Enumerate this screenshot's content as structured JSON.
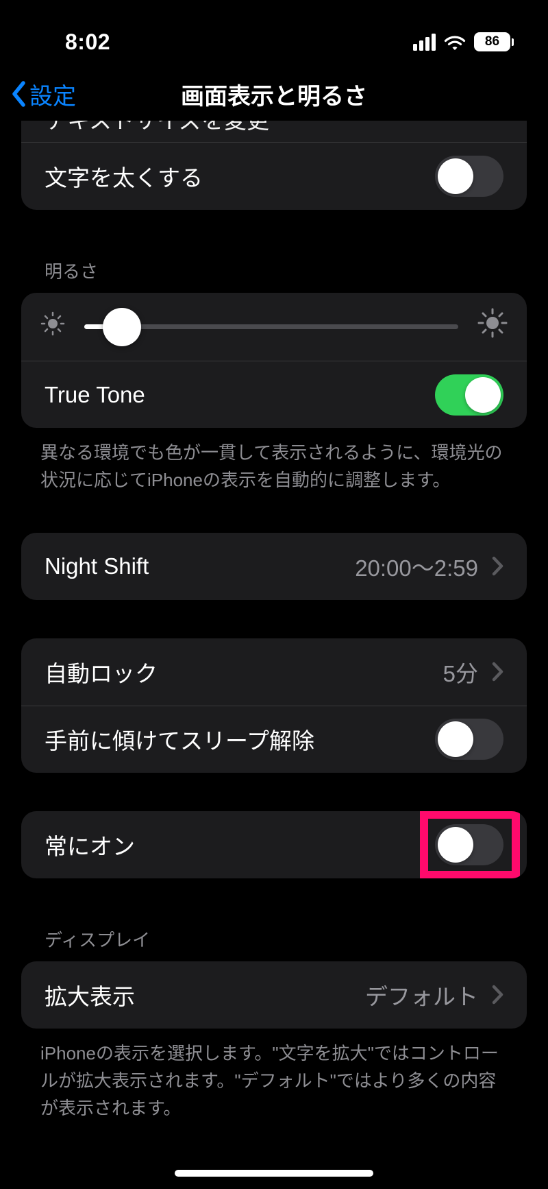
{
  "statusbar": {
    "time": "8:02",
    "battery": "86"
  },
  "nav": {
    "back": "設定",
    "title": "画面表示と明るさ"
  },
  "text_size_row": {
    "label": "テキストサイズを変更"
  },
  "bold_text": {
    "label": "文字を太くする",
    "on": false
  },
  "brightness": {
    "header": "明るさ",
    "slider_pct": 10,
    "truetone_label": "True Tone",
    "truetone_on": true,
    "footer": "異なる環境でも色が一貫して表示されるように、環境光の状況に応じてiPhoneの表示を自動的に調整します。"
  },
  "night_shift": {
    "label": "Night Shift",
    "value": "20:00～2:59"
  },
  "auto_lock": {
    "label": "自動ロック",
    "value": "5分"
  },
  "raise_to_wake": {
    "label": "手前に傾けてスリープ解除",
    "on": false
  },
  "always_on": {
    "label": "常にオン",
    "on": false
  },
  "display": {
    "header": "ディスプレイ",
    "zoom_label": "拡大表示",
    "zoom_value": "デフォルト",
    "footer": "iPhoneの表示を選択します。\"文字を拡大\"ではコントロールが拡大表示されます。\"デフォルト\"ではより多くの内容が表示されます。"
  }
}
